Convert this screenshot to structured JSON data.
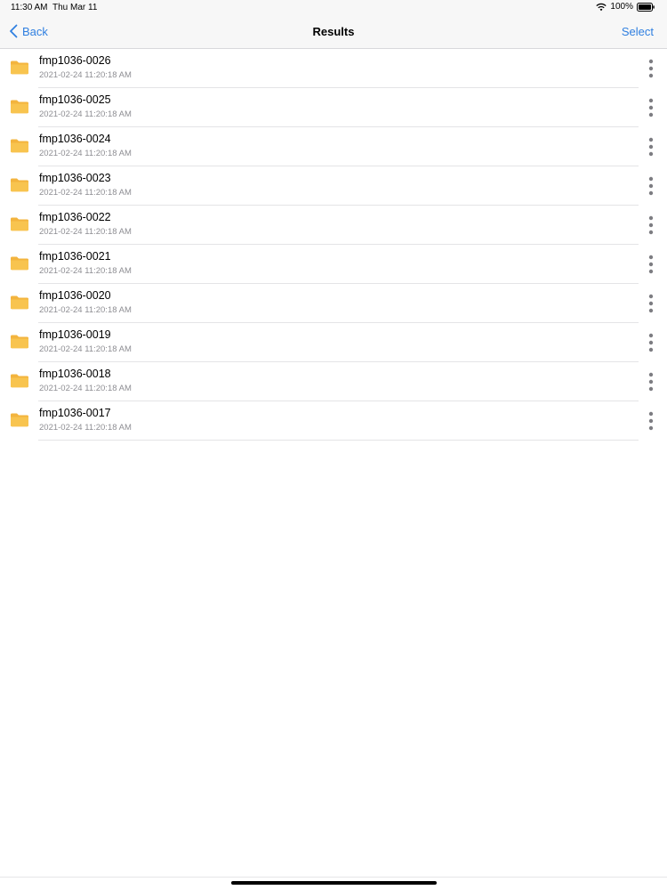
{
  "status_bar": {
    "time": "11:30 AM",
    "date": "Thu Mar 11",
    "battery": "100%",
    "icons": [
      "wifi-icon",
      "battery-icon"
    ]
  },
  "nav": {
    "back_label": "Back",
    "title": "Results",
    "select_label": "Select",
    "accent_color": "#2f7fe0"
  },
  "files": [
    {
      "name": "fmp1036-0026",
      "date": "2021-02-24 11:20:18 AM",
      "icon": "folder-icon"
    },
    {
      "name": "fmp1036-0025",
      "date": "2021-02-24 11:20:18 AM",
      "icon": "folder-icon"
    },
    {
      "name": "fmp1036-0024",
      "date": "2021-02-24 11:20:18 AM",
      "icon": "folder-icon"
    },
    {
      "name": "fmp1036-0023",
      "date": "2021-02-24 11:20:18 AM",
      "icon": "folder-icon"
    },
    {
      "name": "fmp1036-0022",
      "date": "2021-02-24 11:20:18 AM",
      "icon": "folder-icon"
    },
    {
      "name": "fmp1036-0021",
      "date": "2021-02-24 11:20:18 AM",
      "icon": "folder-icon"
    },
    {
      "name": "fmp1036-0020",
      "date": "2021-02-24 11:20:18 AM",
      "icon": "folder-icon"
    },
    {
      "name": "fmp1036-0019",
      "date": "2021-02-24 11:20:18 AM",
      "icon": "folder-icon"
    },
    {
      "name": "fmp1036-0018",
      "date": "2021-02-24 11:20:18 AM",
      "icon": "folder-icon"
    },
    {
      "name": "fmp1036-0017",
      "date": "2021-02-24 11:20:18 AM",
      "icon": "folder-icon"
    }
  ],
  "colors": {
    "folder": "#f8c44f",
    "folder_tab": "#f3b43e",
    "more_dots": "#7d7d82"
  }
}
